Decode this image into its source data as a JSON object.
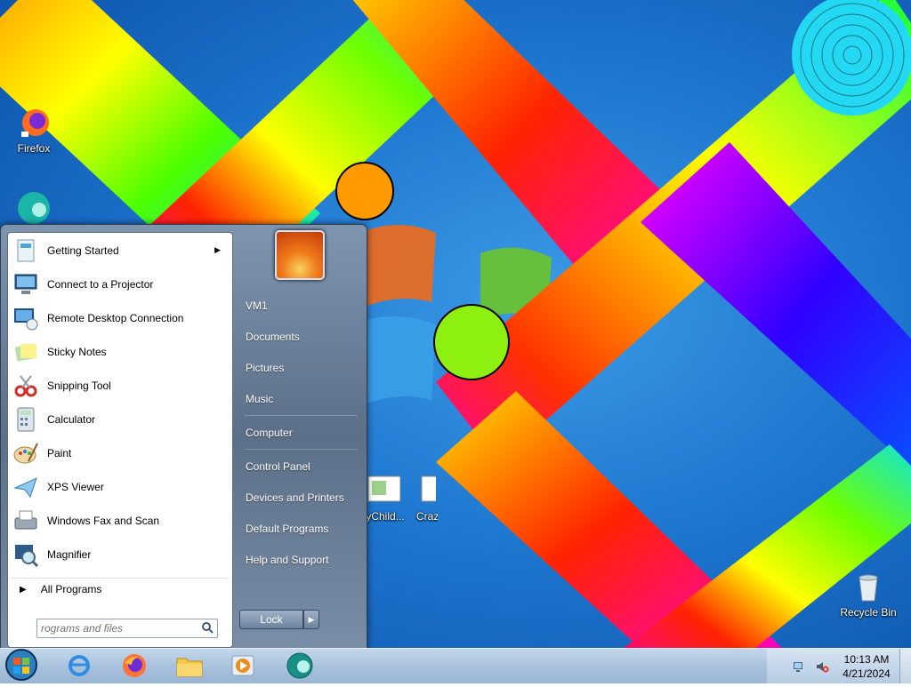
{
  "desktop": {
    "icons": [
      {
        "label": "Firefox",
        "icon": "firefox-icon"
      },
      {
        "label": "zyChild...",
        "icon": "document-icon"
      },
      {
        "label": "Craz",
        "icon": "document-icon"
      },
      {
        "label": "Recycle Bin",
        "icon": "recycle-bin-icon"
      }
    ]
  },
  "start_menu": {
    "programs": [
      {
        "label": "Getting Started",
        "icon": "getting-started-icon",
        "has_submenu": true
      },
      {
        "label": "Connect to a Projector",
        "icon": "projector-icon"
      },
      {
        "label": "Remote Desktop Connection",
        "icon": "remote-desktop-icon"
      },
      {
        "label": "Sticky Notes",
        "icon": "sticky-notes-icon"
      },
      {
        "label": "Snipping Tool",
        "icon": "scissors-icon"
      },
      {
        "label": "Calculator",
        "icon": "calculator-icon"
      },
      {
        "label": "Paint",
        "icon": "paint-palette-icon"
      },
      {
        "label": "XPS Viewer",
        "icon": "xps-viewer-icon"
      },
      {
        "label": "Windows Fax and Scan",
        "icon": "fax-icon"
      },
      {
        "label": "Magnifier",
        "icon": "magnifier-icon"
      }
    ],
    "all_programs": "All Programs",
    "search_placeholder": "rograms and files",
    "right_links": {
      "user": "VM1",
      "documents": "Documents",
      "pictures": "Pictures",
      "music": "Music",
      "computer": "Computer",
      "control_panel": "Control Panel",
      "devices": "Devices and Printers",
      "default_programs": "Default Programs",
      "help": "Help and Support"
    },
    "lock_label": "Lock",
    "lock_arrow": "▶"
  },
  "taskbar": {
    "pinned": [
      "internet-explorer-icon",
      "firefox-icon",
      "file-explorer-icon",
      "media-player-icon",
      "app-globe-icon"
    ],
    "clock_time": "10:13 AM",
    "clock_date": "4/21/2024"
  },
  "colors": {
    "taskbar": "#a9c2dd",
    "start_menu_pane": "#6b7f99",
    "desktop_blue": "#1e76cf"
  }
}
